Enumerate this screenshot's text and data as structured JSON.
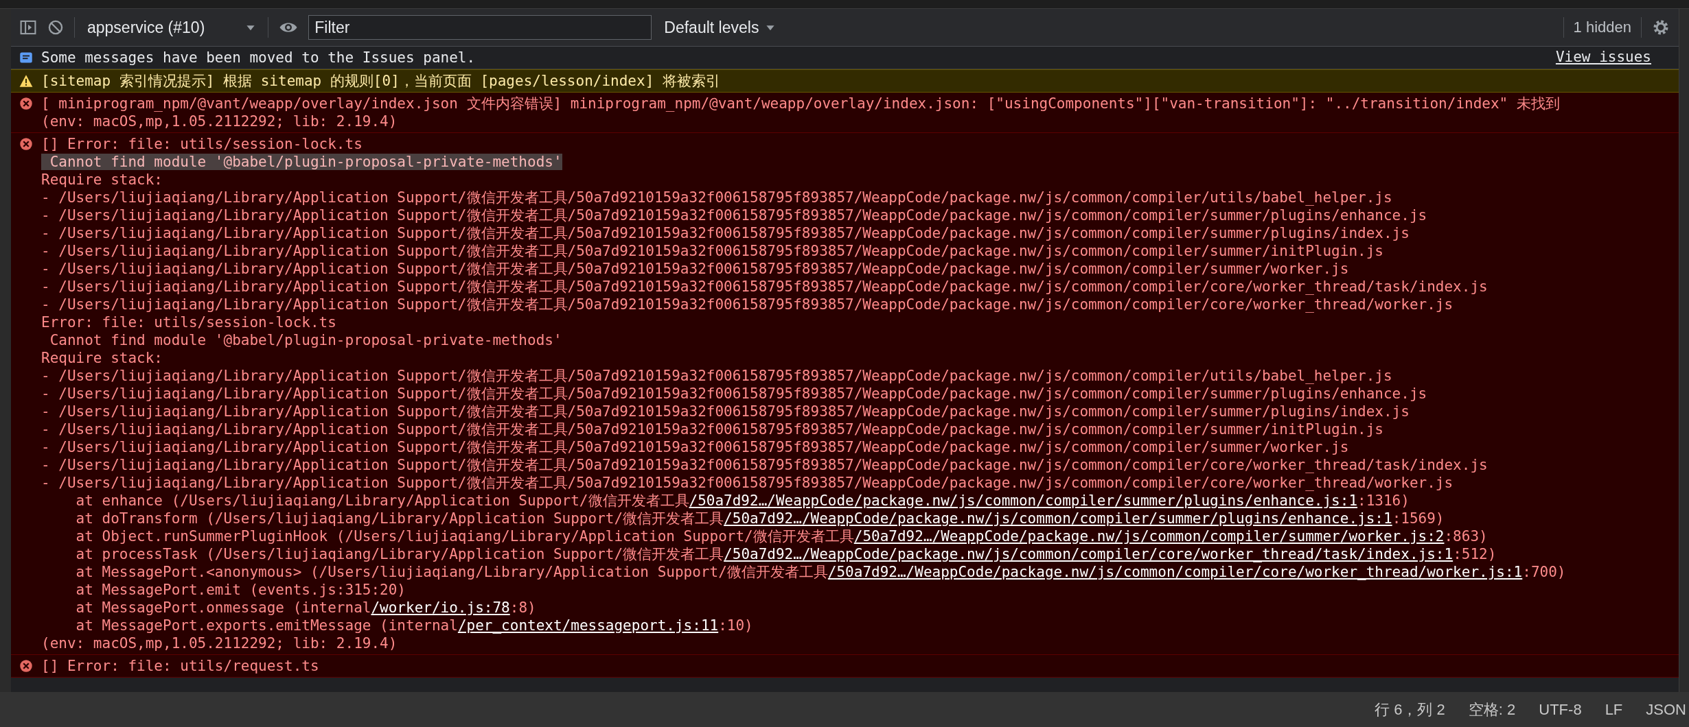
{
  "toolbar": {
    "context": "appservice (#10)",
    "filter": {
      "placeholder": "Filter"
    },
    "levels": "Default levels",
    "hidden_count": "1 hidden"
  },
  "messages": [
    {
      "kind": "info",
      "link": "View issues",
      "lines": [
        {
          "kind": "text",
          "text": "Some messages have been moved to the Issues panel."
        }
      ]
    },
    {
      "kind": "warning",
      "lines": [
        {
          "kind": "text",
          "text": "[sitemap 索引情况提示] 根据 sitemap 的规则[0]，当前页面 [pages/lesson/index] 将被索引"
        }
      ]
    },
    {
      "kind": "error",
      "lines": [
        {
          "kind": "text",
          "text": "[ miniprogram_npm/@vant/weapp/overlay/index.json 文件内容错误] miniprogram_npm/@vant/weapp/overlay/index.json: [\"usingComponents\"][\"van-transition\"]: \"../transition/index\" 未找到"
        },
        {
          "kind": "text",
          "text": "(env: macOS,mp,1.05.2112292; lib: 2.19.4)"
        }
      ]
    },
    {
      "kind": "error",
      "lines": [
        {
          "kind": "text",
          "text": "[] Error: file: utils/session-lock.ts"
        },
        {
          "kind": "highlight",
          "text": " Cannot find module '@babel/plugin-proposal-private-methods'"
        },
        {
          "kind": "text",
          "text": "Require stack:"
        },
        {
          "kind": "text",
          "text": "- /Users/liujiaqiang/Library/Application Support/微信开发者工具/50a7d9210159a32f006158795f893857/WeappCode/package.nw/js/common/compiler/utils/babel_helper.js"
        },
        {
          "kind": "text",
          "text": "- /Users/liujiaqiang/Library/Application Support/微信开发者工具/50a7d9210159a32f006158795f893857/WeappCode/package.nw/js/common/compiler/summer/plugins/enhance.js"
        },
        {
          "kind": "text",
          "text": "- /Users/liujiaqiang/Library/Application Support/微信开发者工具/50a7d9210159a32f006158795f893857/WeappCode/package.nw/js/common/compiler/summer/plugins/index.js"
        },
        {
          "kind": "text",
          "text": "- /Users/liujiaqiang/Library/Application Support/微信开发者工具/50a7d9210159a32f006158795f893857/WeappCode/package.nw/js/common/compiler/summer/initPlugin.js"
        },
        {
          "kind": "text",
          "text": "- /Users/liujiaqiang/Library/Application Support/微信开发者工具/50a7d9210159a32f006158795f893857/WeappCode/package.nw/js/common/compiler/summer/worker.js"
        },
        {
          "kind": "text",
          "text": "- /Users/liujiaqiang/Library/Application Support/微信开发者工具/50a7d9210159a32f006158795f893857/WeappCode/package.nw/js/common/compiler/core/worker_thread/task/index.js"
        },
        {
          "kind": "text",
          "text": "- /Users/liujiaqiang/Library/Application Support/微信开发者工具/50a7d9210159a32f006158795f893857/WeappCode/package.nw/js/common/compiler/core/worker_thread/worker.js"
        },
        {
          "kind": "text",
          "text": "Error: file: utils/session-lock.ts"
        },
        {
          "kind": "text",
          "text": " Cannot find module '@babel/plugin-proposal-private-methods'"
        },
        {
          "kind": "text",
          "text": "Require stack:"
        },
        {
          "kind": "text",
          "text": "- /Users/liujiaqiang/Library/Application Support/微信开发者工具/50a7d9210159a32f006158795f893857/WeappCode/package.nw/js/common/compiler/utils/babel_helper.js"
        },
        {
          "kind": "text",
          "text": "- /Users/liujiaqiang/Library/Application Support/微信开发者工具/50a7d9210159a32f006158795f893857/WeappCode/package.nw/js/common/compiler/summer/plugins/enhance.js"
        },
        {
          "kind": "text",
          "text": "- /Users/liujiaqiang/Library/Application Support/微信开发者工具/50a7d9210159a32f006158795f893857/WeappCode/package.nw/js/common/compiler/summer/plugins/index.js"
        },
        {
          "kind": "text",
          "text": "- /Users/liujiaqiang/Library/Application Support/微信开发者工具/50a7d9210159a32f006158795f893857/WeappCode/package.nw/js/common/compiler/summer/initPlugin.js"
        },
        {
          "kind": "text",
          "text": "- /Users/liujiaqiang/Library/Application Support/微信开发者工具/50a7d9210159a32f006158795f893857/WeappCode/package.nw/js/common/compiler/summer/worker.js"
        },
        {
          "kind": "text",
          "text": "- /Users/liujiaqiang/Library/Application Support/微信开发者工具/50a7d9210159a32f006158795f893857/WeappCode/package.nw/js/common/compiler/core/worker_thread/task/index.js"
        },
        {
          "kind": "text",
          "text": "- /Users/liujiaqiang/Library/Application Support/微信开发者工具/50a7d9210159a32f006158795f893857/WeappCode/package.nw/js/common/compiler/core/worker_thread/worker.js"
        },
        {
          "kind": "link",
          "text": "    at enhance (/Users/liujiaqiang/Library/Application Support/微信开发者工具",
          "link": "/50a7d92…/WeappCode/package.nw/js/common/compiler/summer/plugins/enhance.js:1",
          "after": ":1316)"
        },
        {
          "kind": "link",
          "text": "    at doTransform (/Users/liujiaqiang/Library/Application Support/微信开发者工具",
          "link": "/50a7d92…/WeappCode/package.nw/js/common/compiler/summer/plugins/enhance.js:1",
          "after": ":1569)"
        },
        {
          "kind": "link",
          "text": "    at Object.runSummerPluginHook (/Users/liujiaqiang/Library/Application Support/微信开发者工具",
          "link": "/50a7d92…/WeappCode/package.nw/js/common/compiler/summer/worker.js:2",
          "after": ":863)"
        },
        {
          "kind": "link",
          "text": "    at processTask (/Users/liujiaqiang/Library/Application Support/微信开发者工具",
          "link": "/50a7d92…/WeappCode/package.nw/js/common/compiler/core/worker_thread/task/index.js:1",
          "after": ":512)"
        },
        {
          "kind": "link",
          "text": "    at MessagePort.<anonymous> (/Users/liujiaqiang/Library/Application Support/微信开发者工具",
          "link": "/50a7d92…/WeappCode/package.nw/js/common/compiler/core/worker_thread/worker.js:1",
          "after": ":700)"
        },
        {
          "kind": "text",
          "text": "    at MessagePort.emit (events.js:315:20)"
        },
        {
          "kind": "link",
          "text": "    at MessagePort.onmessage (internal",
          "link": "/worker/io.js:78",
          "after": ":8)"
        },
        {
          "kind": "link",
          "text": "    at MessagePort.exports.emitMessage (internal",
          "link": "/per_context/messageport.js:11",
          "after": ":10)"
        },
        {
          "kind": "text",
          "text": "(env: macOS,mp,1.05.2112292; lib: 2.19.4)"
        }
      ]
    },
    {
      "kind": "error",
      "lines": [
        {
          "kind": "text",
          "text": "[] Error: file: utils/request.ts"
        }
      ]
    }
  ],
  "status_bar": [
    "行 6，列 2",
    "空格: 2",
    "UTF-8",
    "LF",
    "JSON"
  ]
}
